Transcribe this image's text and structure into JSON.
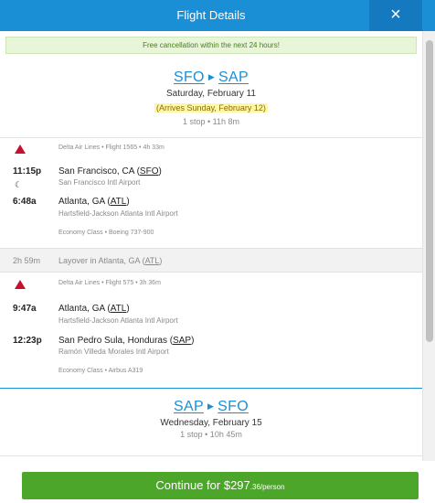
{
  "header": {
    "title": "Flight Details",
    "close_glyph": "×"
  },
  "notice": "Free cancellation within the next 24 hours!",
  "outbound": {
    "origin": "SFO",
    "destination": "SAP",
    "date": "Saturday, February 11",
    "arrives_note": "(Arrives Sunday, February 12)",
    "summary": "1 stop • 11h 8m",
    "legs": [
      {
        "airline_info": "Delta Air Lines • Flight 1565 • 4h 33m",
        "depart_time": "11:15p",
        "depart_city": "San Francisco, CA",
        "depart_code": "SFO",
        "depart_airport": "San Francisco Intl Airport",
        "arrive_time": "6:48a",
        "arrive_city": "Atlanta, GA",
        "arrive_code": "ATL",
        "arrive_airport": "Hartsfield-Jackson Atlanta Intl Airport",
        "cabin": "Economy Class • Boeing 737-900"
      },
      {
        "airline_info": "Delta Air Lines • Flight 575 • 3h 36m",
        "depart_time": "9:47a",
        "depart_city": "Atlanta, GA",
        "depart_code": "ATL",
        "depart_airport": "Hartsfield-Jackson Atlanta Intl Airport",
        "arrive_time": "12:23p",
        "arrive_city": "San Pedro Sula, Honduras",
        "arrive_code": "SAP",
        "arrive_airport": "Ramón Villeda Morales Intl Airport",
        "cabin": "Economy Class • Airbus A319"
      }
    ],
    "layover": {
      "duration": "2h 59m",
      "text": "Layover in Atlanta, GA",
      "code": "ATL"
    }
  },
  "return": {
    "origin": "SAP",
    "destination": "SFO",
    "date": "Wednesday, February 15",
    "summary": "1 stop • 10h 45m"
  },
  "cta": {
    "label": "Continue for $297",
    "cents": ".36/person"
  },
  "colors": {
    "header": "#1a8fd6",
    "cta": "#4ca62a",
    "delta": "#c8102e",
    "notice_bg": "#e8f5d9"
  }
}
